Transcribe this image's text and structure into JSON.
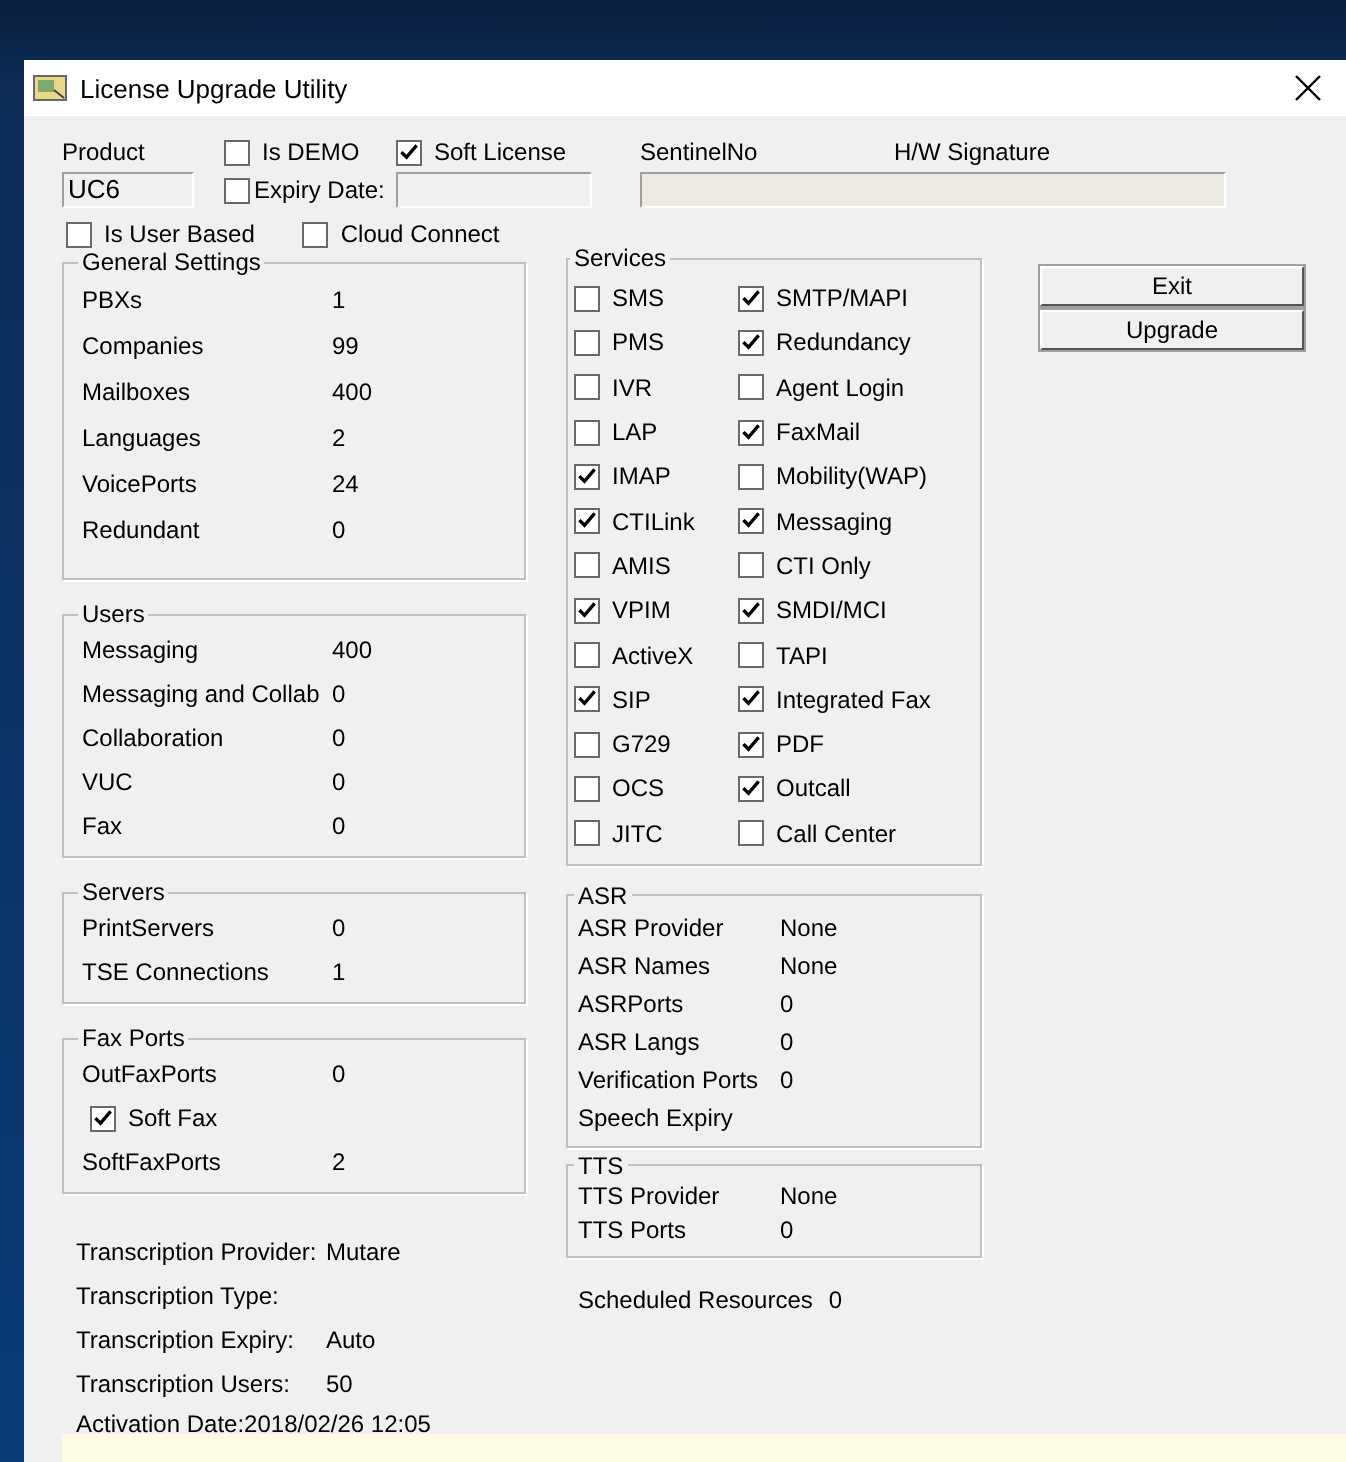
{
  "window": {
    "title": "License Upgrade Utility"
  },
  "header": {
    "product_label": "Product",
    "product_value": "UC6",
    "is_demo": {
      "label": "Is DEMO",
      "checked": false
    },
    "soft_license": {
      "label": "Soft License",
      "checked": true
    },
    "expiry_date": {
      "label": "Expiry Date:",
      "checked": false
    },
    "sentinel_label": "SentinelNo",
    "hw_signature_label": "H/W Signature",
    "is_user_based": {
      "label": "Is User Based",
      "checked": false
    },
    "cloud_connect": {
      "label": "Cloud Connect",
      "checked": false
    }
  },
  "general_settings": {
    "title": "General Settings",
    "rows": [
      {
        "kind": "value",
        "label": "PBXs",
        "value": "1"
      },
      {
        "kind": "value",
        "label": "Companies",
        "value": "99"
      },
      {
        "kind": "value",
        "label": "Mailboxes",
        "value": "400"
      },
      {
        "kind": "value",
        "label": "Languages",
        "value": "2"
      },
      {
        "kind": "value",
        "label": "VoicePorts",
        "value": "24"
      },
      {
        "kind": "value",
        "label": "Redundant",
        "value": "0"
      }
    ]
  },
  "users": {
    "title": "Users",
    "rows": [
      {
        "kind": "value",
        "label": "Messaging",
        "value": "400"
      },
      {
        "kind": "value",
        "label": "Messaging and Collab",
        "value": "0"
      },
      {
        "kind": "value",
        "label": "Collaboration",
        "value": "0"
      },
      {
        "kind": "value",
        "label": "VUC",
        "value": "0"
      },
      {
        "kind": "value",
        "label": "Fax",
        "value": "0"
      }
    ]
  },
  "servers": {
    "title": "Servers",
    "rows": [
      {
        "kind": "value",
        "label": "PrintServers",
        "value": "0"
      },
      {
        "kind": "value",
        "label": "TSE Connections",
        "value": "1"
      }
    ]
  },
  "fax_ports": {
    "title": "Fax Ports",
    "rows": [
      {
        "kind": "value",
        "label": "OutFaxPorts",
        "value": "0"
      },
      {
        "kind": "checkbox",
        "label": "Soft Fax",
        "checked": true
      },
      {
        "kind": "value",
        "label": "SoftFaxPorts",
        "value": "2"
      }
    ]
  },
  "transcription": [
    {
      "label": "Transcription Provider:",
      "value": "Mutare"
    },
    {
      "label": "Transcription Type:"
    },
    {
      "label": "Transcription Expiry:",
      "value": "Auto"
    },
    {
      "label": "Transcription Users:",
      "value": "50"
    }
  ],
  "activation_date": "Activation Date:2018/02/26 12:05",
  "services": {
    "title": "Services",
    "items": [
      {
        "label": "SMS",
        "checked": false
      },
      {
        "label": "SMTP/MAPI",
        "checked": true
      },
      {
        "label": "PMS",
        "checked": false
      },
      {
        "label": "Redundancy",
        "checked": true
      },
      {
        "label": "IVR",
        "checked": false
      },
      {
        "label": "Agent Login",
        "checked": false
      },
      {
        "label": "LAP",
        "checked": false
      },
      {
        "label": "FaxMail",
        "checked": true
      },
      {
        "label": "IMAP",
        "checked": true
      },
      {
        "label": "Mobility(WAP)",
        "checked": false
      },
      {
        "label": "CTILink",
        "checked": true
      },
      {
        "label": "Messaging",
        "checked": true
      },
      {
        "label": "AMIS",
        "checked": false
      },
      {
        "label": "CTI Only",
        "checked": false
      },
      {
        "label": "VPIM",
        "checked": true
      },
      {
        "label": "SMDI/MCI",
        "checked": true
      },
      {
        "label": "ActiveX",
        "checked": false
      },
      {
        "label": "TAPI",
        "checked": false
      },
      {
        "label": "SIP",
        "checked": true
      },
      {
        "label": "Integrated Fax",
        "checked": true
      },
      {
        "label": "G729",
        "checked": false
      },
      {
        "label": "PDF",
        "checked": true
      },
      {
        "label": "OCS",
        "checked": false
      },
      {
        "label": "Outcall",
        "checked": true
      },
      {
        "label": "JITC",
        "checked": false
      },
      {
        "label": "Call Center",
        "checked": false
      }
    ]
  },
  "asr": {
    "title": "ASR",
    "rows": [
      {
        "kind": "value",
        "label": "ASR Provider",
        "value": "None"
      },
      {
        "kind": "value",
        "label": "ASR Names",
        "value": "None"
      },
      {
        "kind": "value",
        "label": "ASRPorts",
        "value": "0"
      },
      {
        "kind": "value",
        "label": "ASR Langs",
        "value": "0"
      },
      {
        "kind": "value",
        "label": "Verification Ports",
        "value": "0"
      },
      {
        "kind": "value",
        "label": "Speech Expiry"
      }
    ]
  },
  "tts": {
    "title": "TTS",
    "rows": [
      {
        "kind": "value",
        "label": "TTS Provider",
        "value": "None"
      },
      {
        "kind": "value",
        "label": "TTS Ports",
        "value": "0"
      }
    ]
  },
  "scheduled_resources": {
    "label": "Scheduled Resources",
    "value": "0"
  },
  "buttons": [
    "Exit",
    "Upgrade"
  ]
}
